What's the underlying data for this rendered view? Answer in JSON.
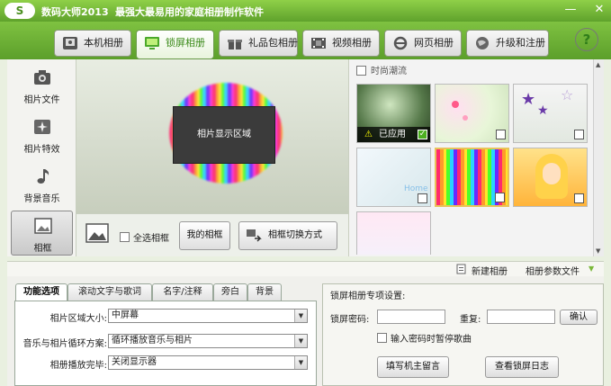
{
  "app": {
    "logo_text": "S",
    "title": "数码大师2013",
    "slogan": "最强大最易用的家庭相册制作软件"
  },
  "window_controls": {
    "minimize": "—",
    "close": "✕"
  },
  "nav_tabs": [
    {
      "label": "本机相册",
      "icon": "photo-album-icon"
    },
    {
      "label": "锁屏相册",
      "icon": "monitor-icon"
    },
    {
      "label": "礼品包相册",
      "icon": "gift-icon"
    },
    {
      "label": "视频相册",
      "icon": "film-icon"
    },
    {
      "label": "网页相册",
      "icon": "ie-browser-icon"
    },
    {
      "label": "升级和注册",
      "icon": "globe-icon"
    }
  ],
  "active_tab": "锁屏相册",
  "help": {
    "label": "?"
  },
  "left_nav": [
    {
      "label": "相片文件",
      "icon": "camera-icon"
    },
    {
      "label": "相片特效",
      "icon": "sparkle-effects-icon"
    },
    {
      "label": "背景音乐",
      "icon": "music-note-icon"
    },
    {
      "label": "相框",
      "icon": "picture-frame-icon"
    }
  ],
  "preview": {
    "photo_area_label": "相片显示区域"
  },
  "toolstrip": {
    "select_all_frames": "全选相框",
    "my_frames": "我的相框",
    "frame_switch_mode": "相框切换方式"
  },
  "thumbnails": {
    "category_label": "时尚潮流",
    "applied_label": "已应用",
    "watermark": "Home"
  },
  "action_bar": {
    "new_album": "新建相册",
    "param_file": "相册参数文件"
  },
  "sub_tabs": [
    "功能选项",
    "滚动文字与歌词",
    "名字/注释",
    "旁白",
    "背景"
  ],
  "options": {
    "area_size_label": "相片区域大小:",
    "area_size_value": "中屏幕",
    "loop_label": "音乐与相片循环方案:",
    "loop_value": "循环播放音乐与相片",
    "finish_label": "相册播放完毕:",
    "finish_value": "关闭显示器"
  },
  "lock_settings": {
    "title": "锁屏相册专项设置:",
    "password_label": "锁屏密码:",
    "repeat_label": "重复:",
    "confirm_button": "确认",
    "pause_music_label": "输入密码时暂停歌曲",
    "owner_message_button": "填写机主留言",
    "view_log_button": "查看锁屏日志"
  },
  "colors": {
    "accent": "#5fa22c",
    "title_green": "#3a8a18"
  }
}
